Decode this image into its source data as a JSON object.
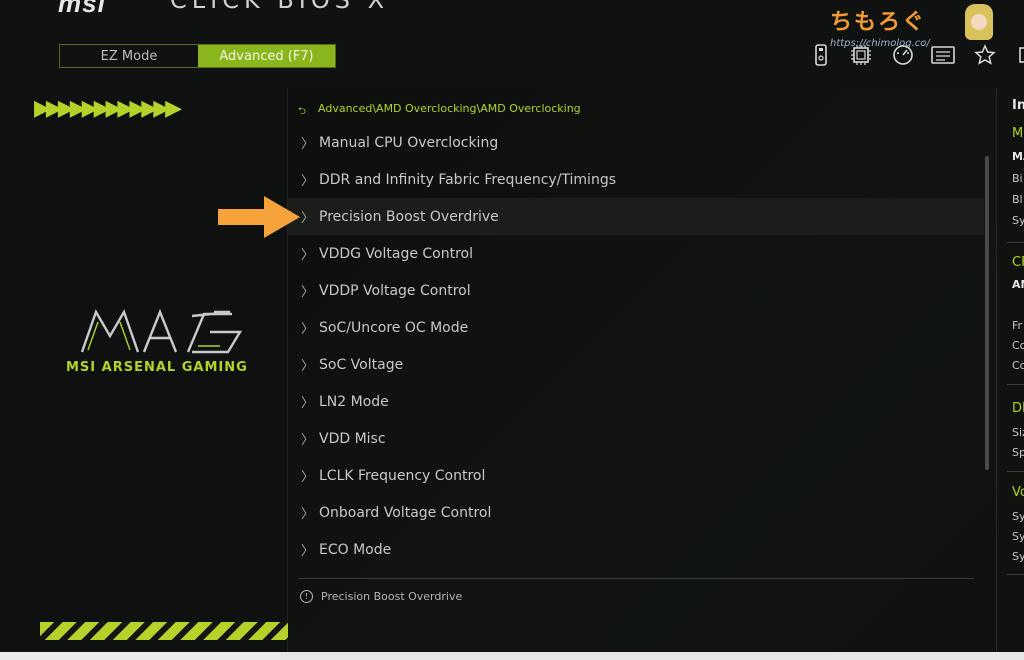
{
  "header": {
    "brand": "msi",
    "bios_title": "CLICK BIOS X",
    "modes": {
      "ez": "EZ Mode",
      "advanced": "Advanced (F7)"
    },
    "active_mode": "advanced",
    "watermark": {
      "jp": "ちもろぐ",
      "url": "https://chimolog.co/"
    },
    "toolbar_icons": [
      "usb-drive-icon",
      "cpu-icon",
      "speedometer-icon",
      "hardware-monitor-icon",
      "favorites-star-icon",
      "search-icon"
    ]
  },
  "left_panel": {
    "chevrons": "▶▶▶▶▶▶▶▶▶▶▶▶",
    "logo_text": "MSI ARSENAL GAMING",
    "accent_color": "#b6d22a"
  },
  "main": {
    "breadcrumb": "Advanced\\AMD Overclocking\\AMD Overclocking",
    "items": [
      {
        "label": "Manual CPU Overclocking"
      },
      {
        "label": "DDR and Infinity Fabric Frequency/Timings"
      },
      {
        "label": "Precision Boost Overdrive"
      },
      {
        "label": "VDDG Voltage Control"
      },
      {
        "label": "VDDP Voltage Control"
      },
      {
        "label": "SoC/Uncore OC Mode"
      },
      {
        "label": "SoC Voltage"
      },
      {
        "label": "LN2 Mode"
      },
      {
        "label": "VDD Misc"
      },
      {
        "label": "LCLK Frequency Control"
      },
      {
        "label": "Onboard Voltage Control"
      },
      {
        "label": "ECO Mode"
      }
    ],
    "selected_item": "Precision Boost Overdrive",
    "help_text": "Precision Boost Overdrive"
  },
  "right_panel": {
    "heading": "In",
    "sections": [
      {
        "head": "M",
        "lines": [
          "MA",
          "Bi",
          "Bl",
          "Sy"
        ]
      },
      {
        "head": "CF",
        "lines": [
          "AM",
          "Fr",
          "Co",
          "Co"
        ]
      },
      {
        "head": "DF",
        "lines": [
          "Siz",
          "Sp"
        ]
      },
      {
        "head": "Vo",
        "lines": [
          "Sys",
          "Sys",
          "Sys"
        ]
      }
    ]
  },
  "colors": {
    "accent": "#b6d22a",
    "highlight_arrow": "#f5a33a",
    "background": "#0b0c0c"
  }
}
